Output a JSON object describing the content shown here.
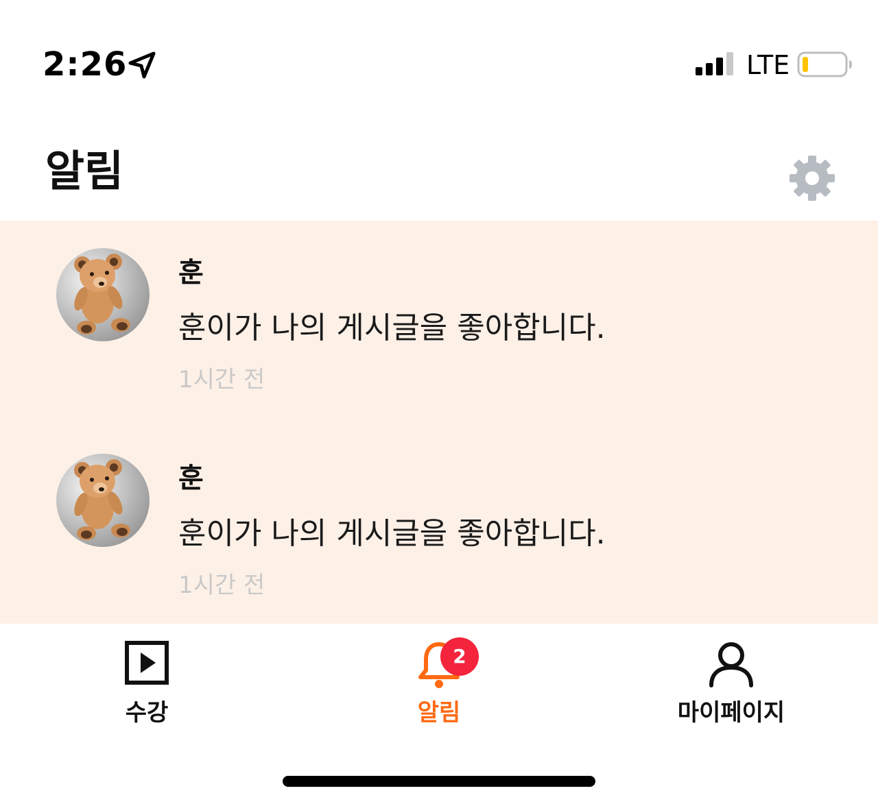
{
  "status_bar": {
    "time": "2:26",
    "network": "LTE",
    "location_icon": "location-arrow-icon",
    "signal_icon": "cellular-signal-icon",
    "battery_icon": "battery-low-icon",
    "battery_color": "#ffc400"
  },
  "header": {
    "title": "알림",
    "settings_icon": "gear-icon"
  },
  "notifications": [
    {
      "avatar": "teddy-bear-avatar",
      "sender": "훈",
      "message": "훈이가 나의 게시글을 좋아합니다.",
      "time": "1시간 전"
    },
    {
      "avatar": "teddy-bear-avatar",
      "sender": "훈",
      "message": "훈이가 나의 게시글을 좋아합니다.",
      "time": "1시간 전"
    }
  ],
  "tab_bar": {
    "tabs": [
      {
        "label": "수강",
        "icon": "play-square-icon",
        "active": false
      },
      {
        "label": "알림",
        "icon": "bell-icon",
        "active": true,
        "badge": "2"
      },
      {
        "label": "마이페이지",
        "icon": "person-icon",
        "active": false
      }
    ],
    "active_color": "#ff6a13",
    "badge_color": "#f3243c"
  },
  "colors": {
    "list_background": "#fdf0e7",
    "time_text": "#c9c9c9"
  }
}
